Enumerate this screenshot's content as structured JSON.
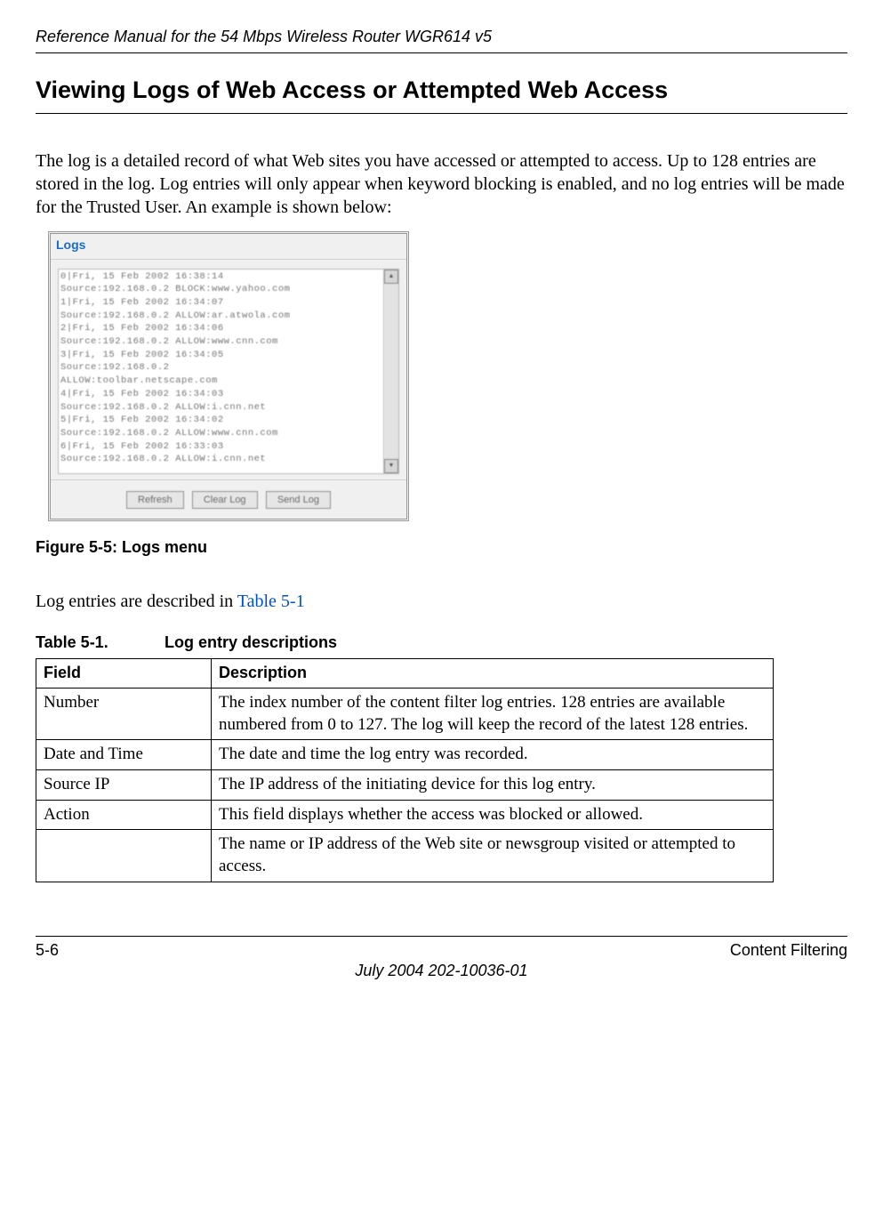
{
  "header_title": "Reference Manual for the 54 Mbps Wireless Router WGR614 v5",
  "section_title": "Viewing Logs of Web Access or Attempted Web Access",
  "intro_text": "The log is a detailed record of what Web sites you have accessed or attempted to access. Up to 128 entries are stored in the log. Log entries will only appear when keyword blocking is enabled, and no log entries will be made for the Trusted User. An example is shown below:",
  "logs_ui": {
    "title": "Logs",
    "entries_text": "0|Fri, 15 Feb 2002 16:38:14\nSource:192.168.0.2 BLOCK:www.yahoo.com\n1|Fri, 15 Feb 2002 16:34:07\nSource:192.168.0.2 ALLOW:ar.atwola.com\n2|Fri, 15 Feb 2002 16:34:06\nSource:192.168.0.2 ALLOW:www.cnn.com\n3|Fri, 15 Feb 2002 16:34:05\nSource:192.168.0.2\nALLOW:toolbar.netscape.com\n4|Fri, 15 Feb 2002 16:34:03\nSource:192.168.0.2 ALLOW:i.cnn.net\n5|Fri, 15 Feb 2002 16:34:02\nSource:192.168.0.2 ALLOW:www.cnn.com\n6|Fri, 15 Feb 2002 16:33:03\nSource:192.168.0.2 ALLOW:i.cnn.net",
    "btn_refresh": "Refresh",
    "btn_clear": "Clear Log",
    "btn_send": "Send Log"
  },
  "figure_caption": "Figure 5-5:  Logs menu",
  "mid_text_pre": "Log entries are described in ",
  "mid_text_link": "Table 5-1",
  "table_caption_label": "Table 5-1.",
  "table_caption_title": "Log entry descriptions",
  "table": {
    "header_field": "Field",
    "header_desc": "Description",
    "rows": [
      {
        "field": "Number",
        "desc": "The index number of the content filter log entries. 128 entries are available numbered from 0 to 127. The log will keep the record of the latest 128 entries."
      },
      {
        "field": "Date and Time",
        "desc": "The date and time the log entry was recorded."
      },
      {
        "field": "Source IP",
        "desc": "The IP address of the initiating device for this log entry."
      },
      {
        "field": "Action",
        "desc": "This field displays whether the access was blocked or allowed."
      },
      {
        "field": "",
        "desc": "The name or IP address of the Web site or newsgroup visited or attempted to access."
      }
    ]
  },
  "footer": {
    "page_num": "5-6",
    "section": "Content Filtering",
    "date_line": "July 2004 202-10036-01"
  }
}
